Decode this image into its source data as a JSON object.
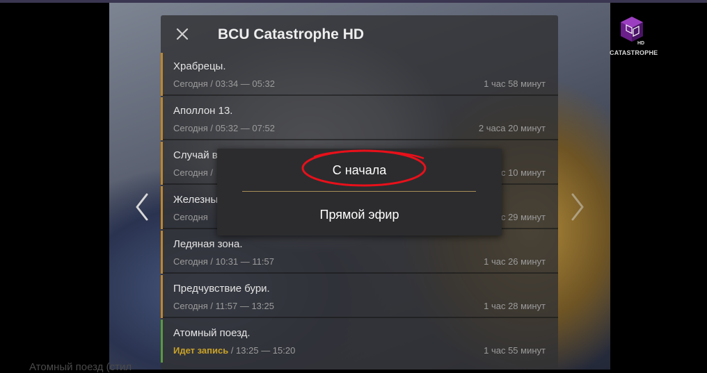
{
  "channel": {
    "title": "BCU Catastrophe HD",
    "logo_text": "CATASTROPHE",
    "logo_hd": "HD"
  },
  "colors": {
    "accent_recorded": "#c0862a",
    "accent_live": "#5a9a3a",
    "recording_text": "#c9a227",
    "annotation": "#e8101a"
  },
  "icons": {
    "close": "close-icon",
    "prev": "chevron-left-icon",
    "next": "chevron-right-icon",
    "logo": "channel-logo-icon"
  },
  "schedule": [
    {
      "title": "Храбрецы.",
      "time": "Сегодня / 03:34 — 05:32",
      "duration": "1 час 58 минут",
      "status": "recorded"
    },
    {
      "title": "Аполлон 13.",
      "time": "Сегодня / 05:32 — 07:52",
      "duration": "2 часа 20 минут",
      "status": "recorded"
    },
    {
      "title": "Случай в",
      "time": "Сегодня /",
      "duration": "с 10 минут",
      "status": "recorded"
    },
    {
      "title": "Железны",
      "time": "Сегодня",
      "duration": "с 29 минут",
      "status": "recorded"
    },
    {
      "title": "Ледяная зона.",
      "time": "Сегодня / 10:31 — 11:57",
      "duration": "1 час 26 минут",
      "status": "recorded"
    },
    {
      "title": "Предчувствие бури.",
      "time": "Сегодня / 11:57 — 13:25",
      "duration": "1 час 28 минут",
      "status": "recorded"
    },
    {
      "title": "Атомный поезд.",
      "recording_label": "Идет запись",
      "time": " / 13:25 — 15:20",
      "duration": "1 час 55 минут",
      "status": "live"
    }
  ],
  "popup": {
    "from_start": "С начала",
    "live": "Прямой эфир"
  },
  "background_caption": "Атомный поезд (стил"
}
